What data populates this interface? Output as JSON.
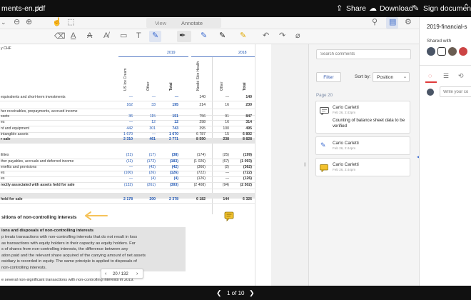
{
  "topbar": {
    "filename": "ments-en.pdf",
    "star": "☆",
    "share": "Share",
    "download": "Download",
    "sign": "Sign document"
  },
  "toolbar": {
    "mode_view": "View",
    "mode_annotate": "Annotate",
    "zoom_value": "25"
  },
  "document": {
    "currency": "y CHF",
    "year_2019": "2019",
    "year_2018": "2018",
    "col_us_ice": "US Ice Cream",
    "col_other1": "Other",
    "col_total1": "Total",
    "col_nestle_skin": "Nestlé Skin Health",
    "col_other2": "Other",
    "col_total2": "Total",
    "rows": [
      {
        "label": "equivalents and short-term investments",
        "c1": "—",
        "c2": "—",
        "c3": "—",
        "c4": "140",
        "c5": "—",
        "c6": "140"
      },
      {
        "label": "",
        "c1": "162",
        "c2": "33",
        "c3": "195",
        "c4": "214",
        "c5": "16",
        "c6": "230"
      },
      {
        "label": "her receivables, prepayments, accrued income",
        "c1": "",
        "c2": "",
        "c3": "",
        "c4": "",
        "c5": "",
        "c6": ""
      },
      {
        "label": "ssets",
        "c1": "36",
        "c2": "115",
        "c3": "151",
        "c4": "756",
        "c5": "91",
        "c6": "847"
      },
      {
        "label": "es",
        "c1": "—",
        "c2": "12",
        "c3": "12",
        "c4": "298",
        "c5": "16",
        "c6": "314"
      },
      {
        "label": "nt and equipment",
        "c1": "442",
        "c2": "301",
        "c3": "743",
        "c4": "395",
        "c5": "100",
        "c6": "495"
      },
      {
        "label": "intangible assets",
        "c1": "1 670",
        "c2": "—",
        "c3": "1 670",
        "c4": "6 787",
        "c5": "15",
        "c6": "6 802"
      },
      {
        "label": "r sale",
        "c1": "2 310",
        "c2": "461",
        "c3": "2 771",
        "c4": "8 590",
        "c5": "238",
        "c6": "8 828"
      },
      {
        "label": "ilities",
        "c1": "(21)",
        "c2": "(17)",
        "c3": "(38)",
        "c4": "(174)",
        "c5": "(25)",
        "c6": "(199)"
      },
      {
        "label": "ther payables, accruals and deferred income",
        "c1": "(11)",
        "c2": "(172)",
        "c3": "(183)",
        "c4": "(1 026)",
        "c5": "(67)",
        "c6": "(1 093)"
      },
      {
        "label": "enefits and provisions",
        "c1": "—",
        "c2": "(42)",
        "c3": "(42)",
        "c4": "(360)",
        "c5": "(2)",
        "c6": "(362)"
      },
      {
        "label": "es",
        "c1": "(100)",
        "c2": "(26)",
        "c3": "(126)",
        "c4": "(722)",
        "c5": "—",
        "c6": "(722)"
      },
      {
        "label": "es",
        "c1": "—",
        "c2": "(4)",
        "c3": "(4)",
        "c4": "(126)",
        "c5": "—",
        "c6": "(126)"
      },
      {
        "label": "rectly associated with assets held for sale",
        "c1": "(132)",
        "c2": "(261)",
        "c3": "(393)",
        "c4": "(2 408)",
        "c5": "(94)",
        "c6": "(2 502)"
      },
      {
        "label": "held for sale",
        "c1": "2 178",
        "c2": "200",
        "c3": "2 378",
        "c4": "6 182",
        "c5": "144",
        "c6": "6 326"
      }
    ],
    "heading": "sitions of non-controlling interests",
    "sub_heading": "ions and disposals of non-controlling interests",
    "para": [
      "p treats transactions with non-controlling interests that do not result in loss",
      "as transactions with equity holders in their capacity as equity holders. For",
      "s of shares from non-controlling interests, the difference between any",
      "ation paid and the relevant share acquired of the carrying amount of net assets",
      "osidiary is recorded in equity. The same principle is applied to disposals of",
      "non-controlling interests."
    ],
    "last_line": "e several non-significant transactions with non-controlling interests in 2019.",
    "page_nav": {
      "prev": "‹",
      "label": "20 / 132",
      "next": "›"
    }
  },
  "comments": {
    "search_placeholder": "Search comments",
    "filter": "Filter",
    "sort_label": "Sort by:",
    "sort_value": "Position",
    "page_label": "Page 20",
    "items": [
      {
        "author": "Carlo Carletti",
        "date": "Feb 26, 2:43pm",
        "text": "Counting of balance sheet data to be verified"
      },
      {
        "author": "Carlo Carletti",
        "date": "Feb 26, 2:44pm",
        "text": ""
      },
      {
        "author": "Carlo Carletti",
        "date": "Feb 26, 2:44pm",
        "text": ""
      }
    ]
  },
  "sidebar": {
    "title": "2019-financial-s",
    "shared_with": "Shared with",
    "comment_placeholder": "Write your co"
  },
  "bottom": {
    "prev": "❮",
    "label": "1 of 10",
    "next": "❯"
  },
  "colors": {
    "highlight_arrow": "#f6c35a",
    "note_icon": "#f2c12e",
    "active_tab": "#e03a3a"
  }
}
